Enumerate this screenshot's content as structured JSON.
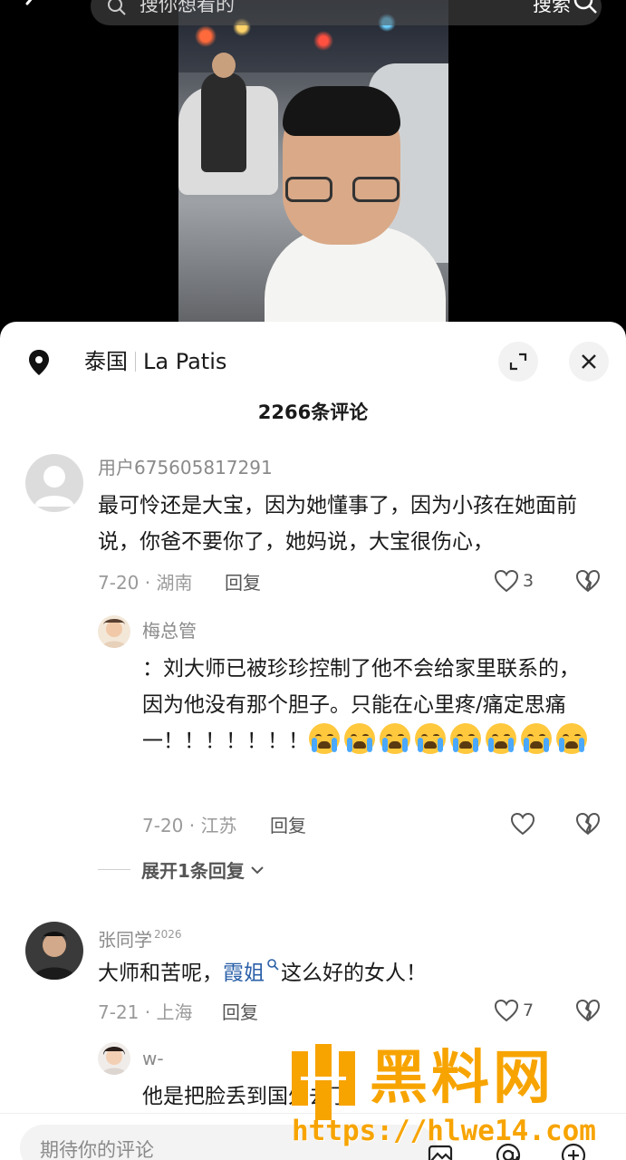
{
  "top_bar": {
    "search_placeholder": "搜你想看的",
    "search_button": "搜索"
  },
  "sheet": {
    "location_country": "泰国",
    "location_place": "La Patis",
    "comment_count": "2266条评论"
  },
  "comments": [
    {
      "username": "用户675605817291",
      "text": "最可怜还是大宝，因为她懂事了，因为小孩在她面前说，你爸不要你了，她妈说，大宝很伤心，",
      "date": "7-20",
      "region": "湖南",
      "reply_label": "回复",
      "likes": "3"
    },
    {
      "username": "梅总管",
      "text": "：刘大师已被珍珍控制了他不会给家里联系的，因为他没有那个胆子。只能在心里疼/痛定思痛一！！！！！！！",
      "date": "7-20",
      "region": "江苏",
      "reply_label": "回复",
      "emoji_count_row1": 5,
      "emoji_count_row2": 3,
      "emoji_name": "crying-face"
    },
    {
      "expand_label": "展开1条回复"
    },
    {
      "username": "张同学",
      "username_sup": "2026",
      "text_before": "大师和苦呢，",
      "mention": "霞姐",
      "text_after": "这么好的女人！",
      "date": "7-21",
      "region": "上海",
      "reply_label": "回复",
      "likes": "7"
    },
    {
      "username": "w-",
      "text": "他是把脸丢到国外去了"
    }
  ],
  "input_bar": {
    "placeholder": "期待你的评论"
  },
  "watermark": {
    "title": "黑料网",
    "url": "https://hlwe14.com"
  },
  "colors": {
    "accent_link": "#2a5fa8",
    "watermark": "#f7a400",
    "sheet_bg": "#ffffff"
  }
}
